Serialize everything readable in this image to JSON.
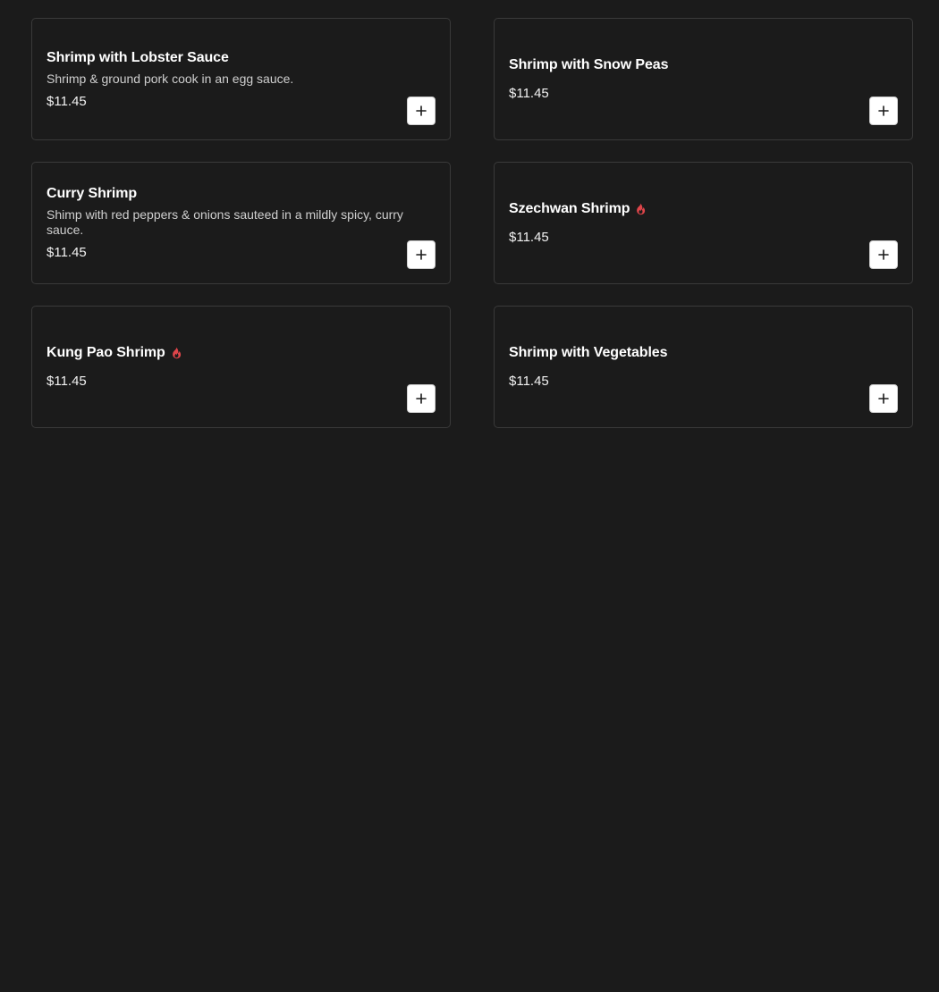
{
  "colors": {
    "background": "#1b1b1b",
    "card_border": "#3a3a3a",
    "spicy_icon": "#e0454a",
    "button_bg": "#ffffff"
  },
  "items": [
    {
      "name": "Shrimp with Lobster Sauce",
      "description": "Shrimp & ground pork cook in an egg sauce.",
      "price": "$11.45",
      "spicy": false,
      "add_icon": "plus-icon"
    },
    {
      "name": "Shrimp with Snow Peas",
      "description": "",
      "price": "$11.45",
      "spicy": false,
      "add_icon": "plus-icon"
    },
    {
      "name": "Curry Shrimp",
      "description": "Shimp with red peppers & onions sauteed in a mildly spicy, curry sauce.",
      "price": "$11.45",
      "spicy": false,
      "add_icon": "plus-icon"
    },
    {
      "name": "Szechwan Shrimp",
      "description": "",
      "price": "$11.45",
      "spicy": true,
      "add_icon": "plus-icon"
    },
    {
      "name": "Kung Pao Shrimp",
      "description": "",
      "price": "$11.45",
      "spicy": true,
      "add_icon": "plus-icon"
    },
    {
      "name": "Shrimp with Vegetables",
      "description": "",
      "price": "$11.45",
      "spicy": false,
      "add_icon": "plus-icon"
    }
  ]
}
